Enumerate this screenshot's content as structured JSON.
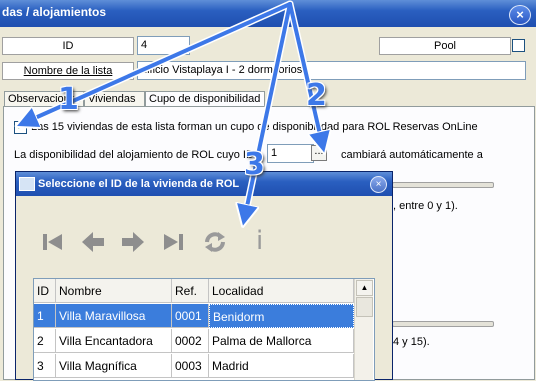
{
  "window": {
    "title": "das / alojamientos",
    "close": "×"
  },
  "form": {
    "id_label": "ID",
    "id_value": "4",
    "pool_label": "Pool",
    "list_name_label": "Nombre de la lista",
    "list_name_value": "dificio Vistaplaya I -  2 dormitorios"
  },
  "tabs": [
    {
      "label": "Observaciones"
    },
    {
      "label": "Viviendas"
    },
    {
      "label": "Cupo de disponibilidad"
    }
  ],
  "panel": {
    "checkbox_text": "Las 15 viviendas de esta lista forman un cupo de disponibilidad para ROL Reservas OnLine",
    "disp_text": "La disponibilidad del alojamiento de ROL cuyo ID",
    "disp_id": "1",
    "ellipsis": "...",
    "change_text": "cambiará automáticamente a",
    "range1_text": ", entre 0 y 1).",
    "range2_text": "4 y 15)."
  },
  "dialog": {
    "title": "Seleccione el ID de la vivienda de ROL",
    "close": "×",
    "info": "i",
    "columns": [
      "ID",
      "Nombre",
      "Ref.",
      "Localidad"
    ],
    "rows": [
      {
        "id": "1",
        "nombre": "Villa Maravillosa",
        "ref": "0001",
        "localidad": "Benidorm"
      },
      {
        "id": "2",
        "nombre": "Villa Encantadora",
        "ref": "0002",
        "localidad": "Palma de Mallorca"
      },
      {
        "id": "3",
        "nombre": "Villa Magnífica",
        "ref": "0003",
        "localidad": "Madrid"
      }
    ]
  },
  "annotations": {
    "n1": "1",
    "n2": "2",
    "n3": "3"
  },
  "colors": {
    "title_blue": "#2a5fc0",
    "selection": "#3b7ddc",
    "arrow": "#3d78e8"
  }
}
